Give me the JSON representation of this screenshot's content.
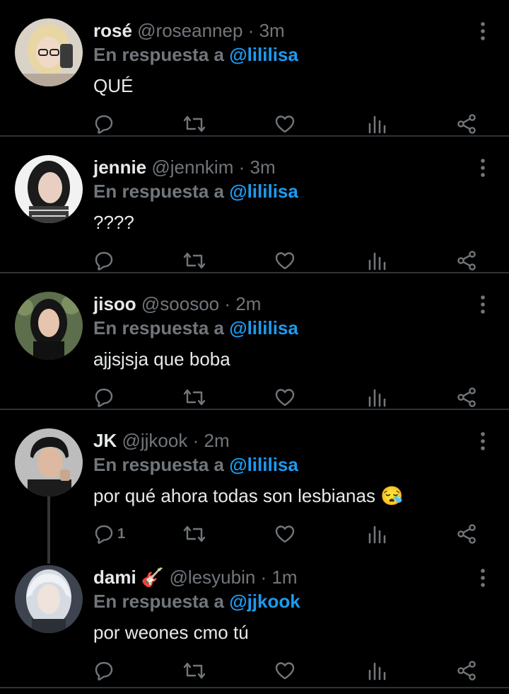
{
  "reply_prefix": "En respuesta a",
  "tweets": [
    {
      "name": "rosé",
      "handle": "@roseannep",
      "dot": "·",
      "time": "3m",
      "reply_to": "@lililisa",
      "text": "QUÉ",
      "replies": "",
      "avatar": "avatar-rose"
    },
    {
      "name": "jennie",
      "handle": "@jennkim",
      "dot": "·",
      "time": "3m",
      "reply_to": "@lililisa",
      "text": "????",
      "replies": "",
      "avatar": "avatar-jennie"
    },
    {
      "name": "jisoo",
      "handle": "@soosoo",
      "dot": "·",
      "time": "2m",
      "reply_to": "@lililisa",
      "text": "ajjsjsja que boba",
      "replies": "",
      "avatar": "avatar-jisoo"
    },
    {
      "name": "JK",
      "handle": "@jjkook",
      "dot": "·",
      "time": "2m",
      "reply_to": "@lililisa",
      "text": "por qué ahora todas son lesbianas 😪",
      "replies": "1",
      "avatar": "avatar-jk"
    },
    {
      "name": "dami 🎸",
      "handle": "@lesyubin",
      "dot": "·",
      "time": "1m",
      "reply_to": "@jjkook",
      "text": "por weones cmo tú",
      "replies": "",
      "avatar": "avatar-dami"
    }
  ],
  "colors": {
    "background": "#000000",
    "text": "#e7e9ea",
    "muted": "#71767b",
    "link": "#1d9bf0",
    "divider": "#2f3336"
  }
}
